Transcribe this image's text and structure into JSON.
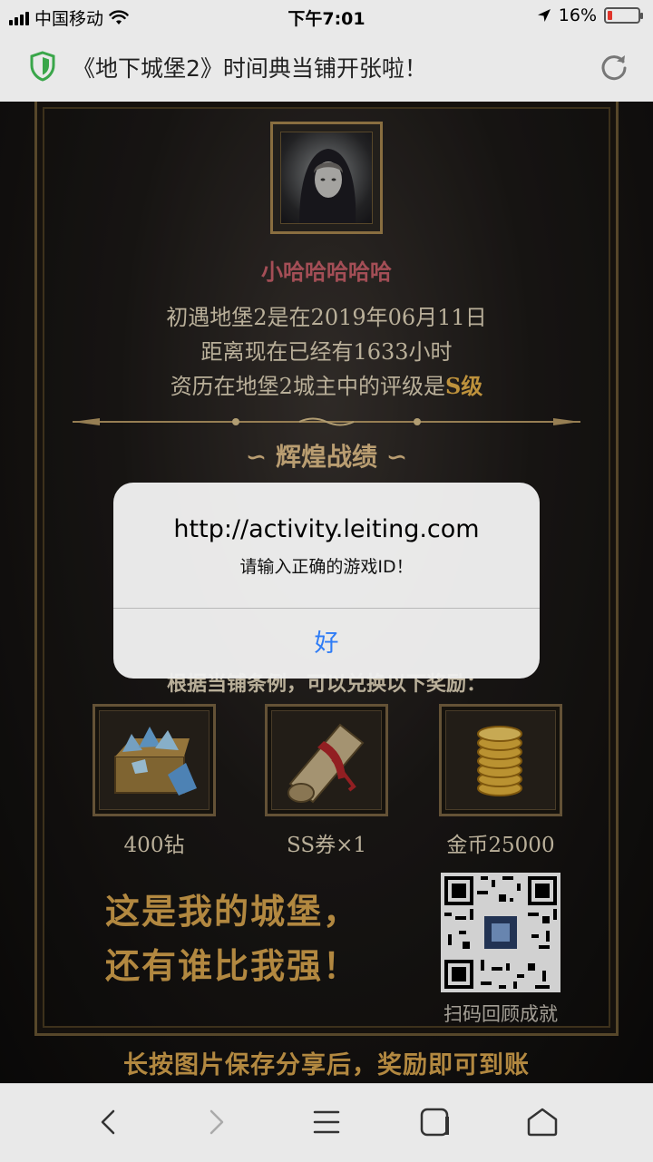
{
  "status_bar": {
    "carrier": "中国移动",
    "time": "下午7:01",
    "battery_percent": "16%",
    "battery_level": 0.16,
    "battery_color": "#e0352b"
  },
  "browser": {
    "page_title": "《地下城堡2》时间典当铺开张啦！",
    "shield_color": "#3aa64a",
    "icons": [
      "shield-icon",
      "reload-icon"
    ]
  },
  "page": {
    "player_name": "小哈哈哈哈哈",
    "info_line_1": "初遇地堡2是在2019年06月11日",
    "info_line_2": "距离现在已经有1633小时",
    "info_line_3_prefix": "资历在地堡2城主中的评级是",
    "info_line_3_grade": "S级",
    "section_title": "辉煌战绩",
    "reward_desc": "根据当铺条例，可以兑换以下奖励：",
    "rewards": [
      {
        "label": "400钻",
        "icon": "diamond-chest-icon"
      },
      {
        "label": "SS券×1",
        "icon": "scroll-icon"
      },
      {
        "label": "金币25000",
        "icon": "gold-coins-icon"
      }
    ],
    "slogan_line_1": "这是我的城堡，",
    "slogan_line_2": "还有谁比我强！",
    "qr_label": "扫码回顾成就",
    "footer_note": "长按图片保存分享后，奖励即可到账"
  },
  "alert": {
    "title": "http://activity.leiting.com",
    "message": "请输入正确的游戏ID！",
    "ok_label": "好"
  },
  "toolbar": {
    "icons": [
      "back-icon",
      "forward-icon",
      "menu-icon",
      "tabs-icon",
      "home-icon"
    ]
  }
}
